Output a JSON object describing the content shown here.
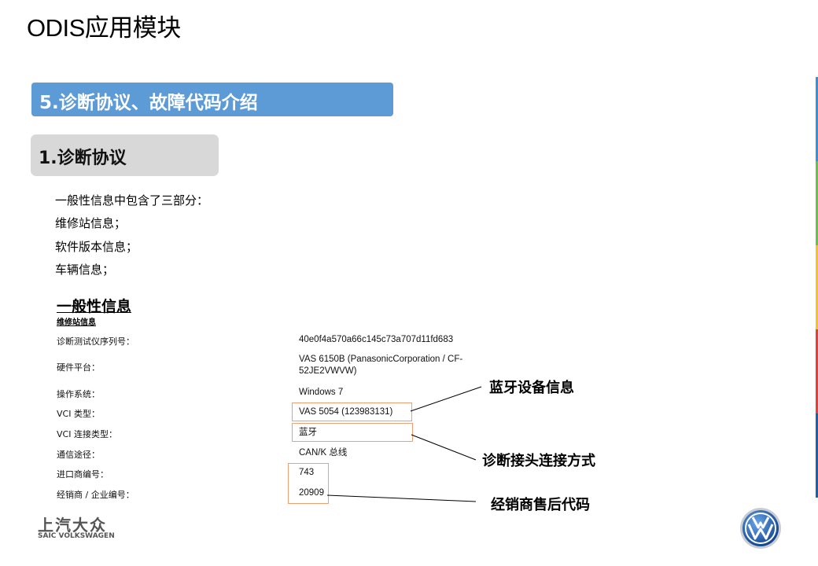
{
  "title": "ODIS应用模块",
  "section_header": "5.诊断协议、故障代码介绍",
  "subsection_header": "1.诊断协议",
  "intro_lines": [
    "一般性信息中包含了三部分：",
    "维修站信息；",
    "软件版本信息；",
    "车辆信息；"
  ],
  "general_info_heading": "一般性信息",
  "workshop_info_heading": "维修站信息",
  "info_rows": [
    {
      "label": "诊断测试仪序列号：",
      "value": "40e0f4a570a66c145c73a707d11fd683"
    },
    {
      "label": "硬件平台：",
      "value": "VAS 6150B (PanasonicCorporation / CF-52JE2VWVW)"
    },
    {
      "label": "操作系统：",
      "value": "Windows 7"
    },
    {
      "label": "VCI 类型：",
      "value": "VAS 5054 (123983131)"
    },
    {
      "label": "VCI 连接类型：",
      "value": "蓝牙"
    },
    {
      "label": "通信途径：",
      "value": "CAN/K 总线"
    },
    {
      "label": "进口商编号：",
      "value": "743"
    },
    {
      "label": "经销商 / 企业编号：",
      "value": "20909"
    }
  ],
  "callouts": {
    "bluetooth_device": "蓝牙设备信息",
    "connection_method": "诊断接头连接方式",
    "dealer_code": "经销商售后代码"
  },
  "brand": {
    "name_cn": "上汽大众",
    "name_en": "SAIC VOLKSWAGEN"
  },
  "colors": {
    "section_bar": "#5c9bd6",
    "subsection_bar": "#d8d8d8",
    "highlight_box": "#f0a070",
    "right_strip": [
      "#3b8fd8",
      "#6cc04a",
      "#f2c230",
      "#e0413a",
      "#1f5fa8"
    ]
  }
}
